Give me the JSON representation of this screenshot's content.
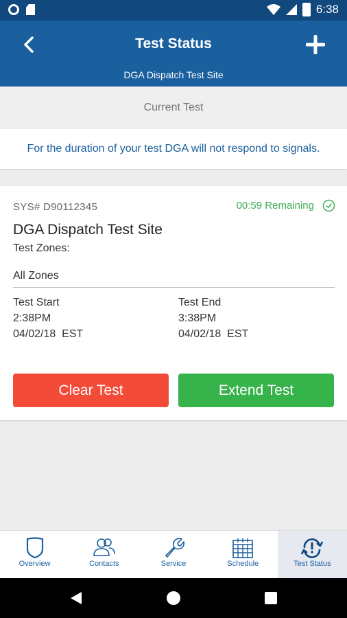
{
  "status_bar": {
    "time": "6:38"
  },
  "header": {
    "title": "Test Status",
    "subtitle": "DGA Dispatch Test Site"
  },
  "section_label": "Current Test",
  "notice": "For the duration of your test DGA will not respond to signals.",
  "test": {
    "sys_number": "SYS# D90112345",
    "remaining": "00:59 Remaining",
    "site_name": "DGA Dispatch Test Site",
    "zones_label": "Test Zones:",
    "zones_value": "All Zones",
    "start_label": "Test Start",
    "start_time": "2:38PM",
    "start_date": "04/02/18  EST",
    "end_label": "Test End",
    "end_time": "3:38PM",
    "end_date": "04/02/18  EST"
  },
  "actions": {
    "clear_label": "Clear Test",
    "extend_label": "Extend Test"
  },
  "bottom_nav": [
    {
      "label": "Overview",
      "icon": "shield-icon"
    },
    {
      "label": "Contacts",
      "icon": "contacts-icon"
    },
    {
      "label": "Service",
      "icon": "wrench-icon"
    },
    {
      "label": "Schedule",
      "icon": "calendar-icon"
    },
    {
      "label": "Test Status",
      "icon": "test-status-icon",
      "active": true
    }
  ],
  "colors": {
    "primary": "#1a5f9e",
    "status_bar": "#11497f",
    "remaining": "#3dab54",
    "clear_button": "#f24b38",
    "extend_button": "#36b34a"
  }
}
